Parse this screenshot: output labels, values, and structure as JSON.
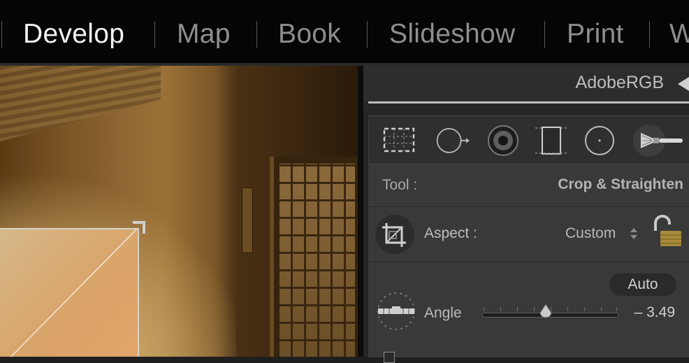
{
  "modules": {
    "items": [
      {
        "label": "Develop",
        "active": true
      },
      {
        "label": "Map",
        "active": false
      },
      {
        "label": "Book",
        "active": false
      },
      {
        "label": "Slideshow",
        "active": false
      },
      {
        "label": "Print",
        "active": false
      },
      {
        "label": "W",
        "active": false
      }
    ]
  },
  "panel": {
    "profile_label": "AdobeRGB",
    "tools": [
      "crop-overlay-icon",
      "spot-removal-icon",
      "red-eye-icon",
      "graduated-filter-icon",
      "radial-filter-icon",
      "adjustment-brush-icon"
    ],
    "tool_row": {
      "label": "Tool :",
      "value": "Crop & Straighten"
    },
    "aspect_row": {
      "label": "Aspect :",
      "value": "Custom",
      "icons": [
        "crop-frame-icon",
        "lock-icon"
      ]
    },
    "angle_row": {
      "label": "Angle",
      "auto_label": "Auto",
      "value": "– 3.49",
      "level": -3.49,
      "icon": "straighten-level-icon"
    }
  },
  "colors": {
    "active_module": "#f2f2f2",
    "inactive_module": "#8e8e8e",
    "panel_bg": "#393939"
  }
}
